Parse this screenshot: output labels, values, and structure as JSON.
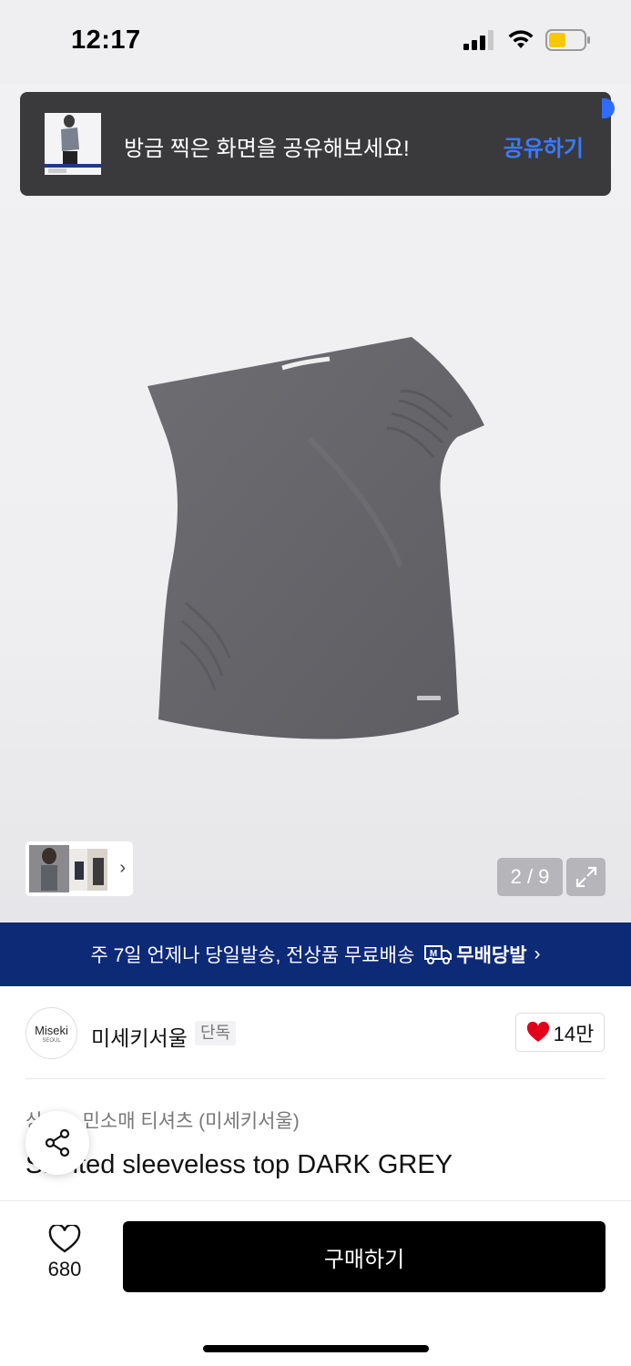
{
  "status": {
    "time": "12:17"
  },
  "toast": {
    "message": "방금 찍은 화면을 공유해보세요!",
    "action": "공유하기"
  },
  "gallery": {
    "counter": "2 / 9"
  },
  "banner": {
    "text": "주 7일 언제나 당일발송, 전상품 무료배송",
    "badge": "무배당발",
    "badge_mark": "M"
  },
  "brand": {
    "logo_text": "Miseki",
    "logo_sub": "SEOUL",
    "name": "미세키서울",
    "tag": "단독",
    "likes": "14만"
  },
  "product": {
    "category": "상의 > 민소매 티셔츠 (미세키서울)",
    "title": "Slanted sleeveless top DARK GREY"
  },
  "bottom": {
    "wish_count": "680",
    "buy_label": "구매하기"
  },
  "colors": {
    "banner": "#0d2a77",
    "toast_bg": "#3a3a3c",
    "toast_action": "#3b7bff",
    "heart": "#e3001b",
    "garment": "#66666b"
  },
  "icons": [
    "signal-icon",
    "wifi-icon",
    "battery-icon",
    "expand-icon",
    "heart-icon",
    "share-icon",
    "truck-icon",
    "chevron-right-icon"
  ]
}
